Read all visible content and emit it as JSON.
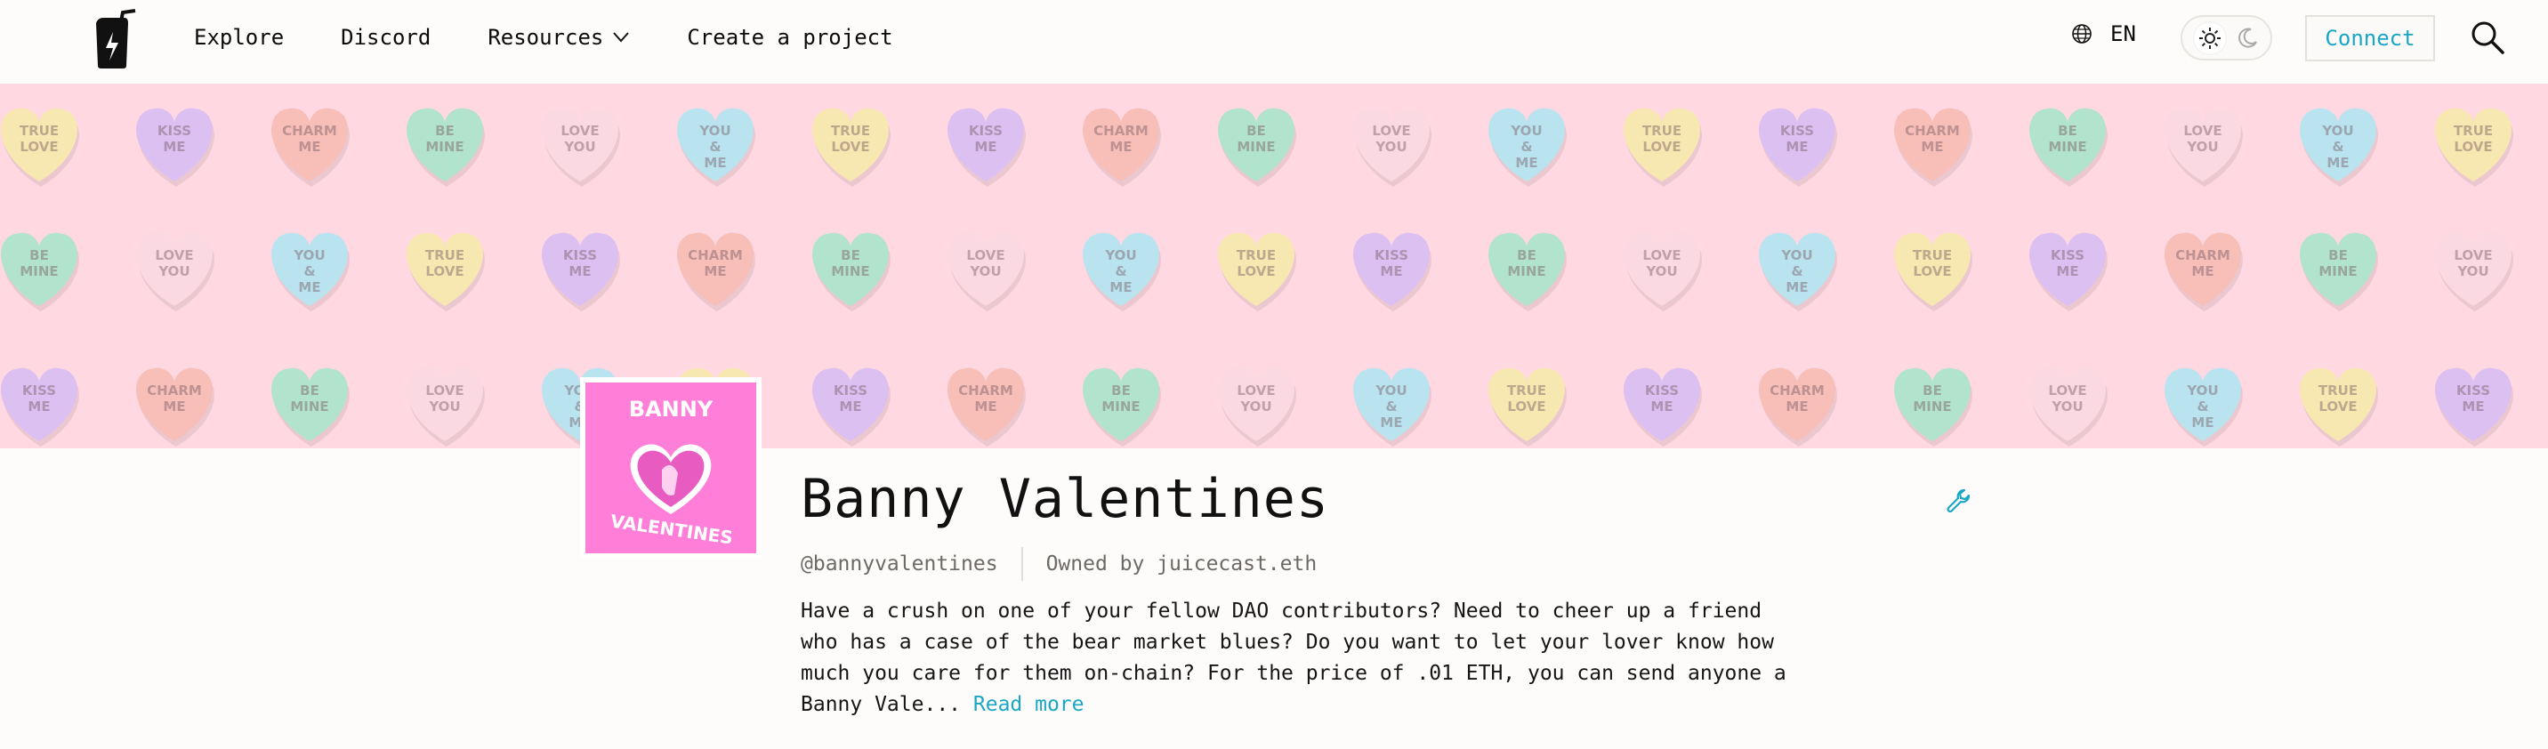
{
  "nav": {
    "links": [
      "Explore",
      "Discord",
      "Resources",
      "Create a project"
    ],
    "language": "EN",
    "connect_label": "Connect",
    "icons": [
      "juicebox-logo-icon",
      "chevron-down-icon",
      "globe-icon",
      "sun-icon",
      "moon-icon",
      "search-icon"
    ]
  },
  "banner": {
    "heart_texts": [
      "TRUE LOVE",
      "KISS ME",
      "CHARM ME",
      "BE MINE",
      "LOVE YOU",
      "YOU & ME"
    ],
    "heart_colors": {
      "TRUE LOVE": "#f7e7b0",
      "KISS ME": "#dcc0f1",
      "CHARM ME": "#f8beb8",
      "BE MINE": "#b2e3cd",
      "LOVE YOU": "#fbd9e2",
      "YOU & ME": "#b9e3ef"
    },
    "rows": [
      [
        "TRUE LOVE",
        "KISS ME",
        "CHARM ME",
        "BE MINE",
        "LOVE YOU",
        "YOU & ME",
        "TRUE LOVE",
        "KISS ME",
        "CHARM ME",
        "BE MINE",
        "LOVE YOU",
        "YOU & ME",
        "TRUE LOVE",
        "KISS ME",
        "CHARM ME",
        "BE MINE",
        "LOVE YOU",
        "YOU & ME",
        "TRUE LOVE"
      ],
      [
        "BE MINE",
        "LOVE YOU",
        "YOU & ME",
        "TRUE LOVE",
        "KISS ME",
        "CHARM ME",
        "BE MINE",
        "LOVE YOU",
        "YOU & ME",
        "TRUE LOVE",
        "KISS ME",
        "BE MINE",
        "LOVE YOU",
        "YOU & ME",
        "TRUE LOVE",
        "KISS ME",
        "CHARM ME",
        "BE MINE",
        "LOVE YOU"
      ],
      [
        "KISS ME",
        "CHARM ME",
        "BE MINE",
        "LOVE YOU",
        "YOU & ME",
        "TRUE LOVE",
        "KISS ME",
        "CHARM ME",
        "BE MINE",
        "LOVE YOU",
        "YOU & ME",
        "TRUE LOVE",
        "KISS ME",
        "CHARM ME",
        "BE MINE",
        "LOVE YOU",
        "YOU & ME",
        "TRUE LOVE",
        "KISS ME"
      ]
    ]
  },
  "project": {
    "avatar_text_top": "BANNY",
    "avatar_text_bottom": "VALENTINES",
    "avatar_color": "#ff7fd8",
    "title": "Banny Valentines",
    "handle": "@bannyvalentines",
    "owner": "Owned by juicecast.eth",
    "description": "Have a crush on one of your fellow DAO contributors? Need to cheer up a friend who has a case of the bear market blues? Do you want to let your lover know how much you care for them on-chain? For the price of .01 ETH, you can send anyone a Banny Vale...",
    "read_more": "Read more",
    "accent": "#19a7c5"
  }
}
